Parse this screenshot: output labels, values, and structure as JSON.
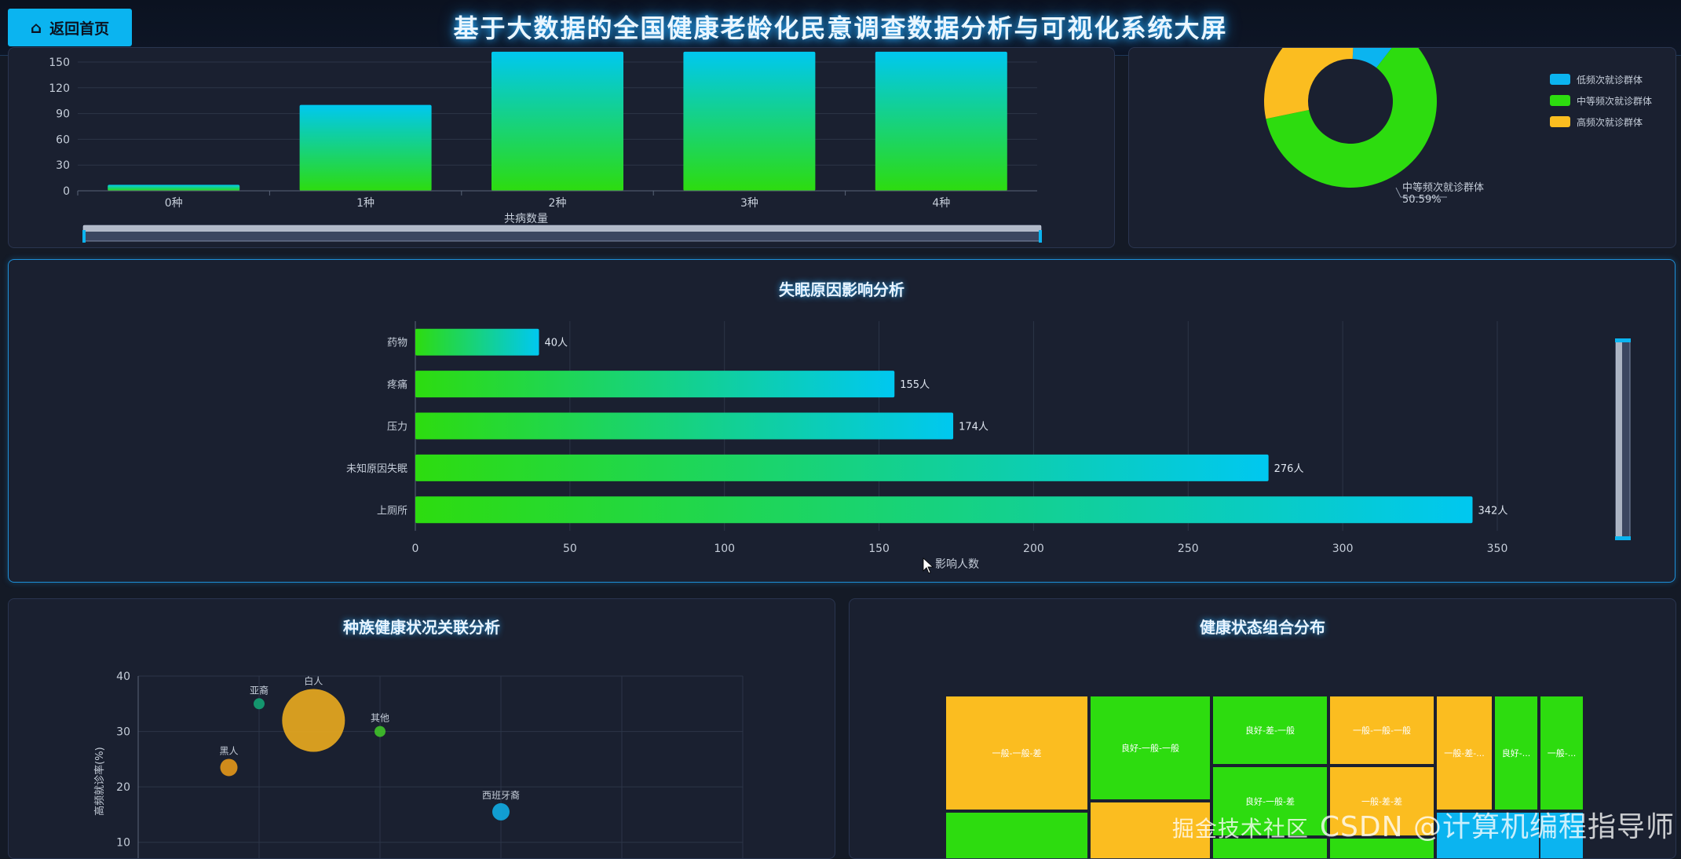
{
  "header": {
    "back_label": "返回首页",
    "title": "基于大数据的全国健康老龄化民意调查数据分析与可视化系统大屏"
  },
  "watermark": "CSDN @计算机编程指导师",
  "watermark2": "掘金技术社区",
  "colors": {
    "accent": "#0bb4f0",
    "green": "#2ddc0f",
    "cyan": "#00c8f0",
    "orange": "#fbbd20",
    "panel": "#1a2030"
  },
  "panels": {
    "insomnia_title": "失眠原因影响分析",
    "race_title": "种族健康状况关联分析",
    "health_title": "健康状态组合分布"
  },
  "chart_data": [
    {
      "type": "bar",
      "categories": [
        "0种",
        "1种",
        "2种",
        "3种",
        "4种"
      ],
      "values": [
        7,
        100,
        165,
        165,
        165
      ],
      "ylim": [
        0,
        150
      ],
      "yticks": [
        "150",
        "120",
        "90",
        "60",
        "30",
        "0"
      ],
      "xlabel": "共病数量",
      "ylabel": "",
      "title": ""
    },
    {
      "type": "pie",
      "legend": [
        "低频次就诊群体",
        "中等频次就诊群体",
        "高频次就诊群体"
      ],
      "values": [
        8,
        50.59,
        24
      ],
      "callout": {
        "name": "中等频次就诊群体",
        "pct": "50.59%"
      },
      "colors": [
        "#0bb4f0",
        "#2ddc0f",
        "#fbbd20"
      ]
    },
    {
      "type": "bar",
      "orientation": "horizontal",
      "categories": [
        "药物",
        "疼痛",
        "压力",
        "未知原因失眠",
        "上厕所"
      ],
      "values": [
        40,
        155,
        174,
        276,
        342
      ],
      "labels": [
        "40人",
        "155人",
        "174人",
        "276人",
        "342人"
      ],
      "xlim": [
        0,
        350
      ],
      "xticks": [
        "0",
        "50",
        "100",
        "150",
        "200",
        "250",
        "300",
        "350"
      ],
      "xlabel": "影响人数",
      "title": "失眠原因影响分析"
    },
    {
      "type": "scatter",
      "points": [
        {
          "name": "亚裔",
          "x": 1.0,
          "y": 35,
          "size": 14,
          "color": "#13a073"
        },
        {
          "name": "白人",
          "x": 1.45,
          "y": 32,
          "size": 80,
          "color": "#e6a81f"
        },
        {
          "name": "黑人",
          "x": 0.75,
          "y": 23.5,
          "size": 22,
          "color": "#e0951a"
        },
        {
          "name": "其他",
          "x": 2.0,
          "y": 30,
          "size": 14,
          "color": "#3fbf2a"
        },
        {
          "name": "西班牙裔",
          "x": 3.0,
          "y": 15.5,
          "size": 22,
          "color": "#10a8e0"
        }
      ],
      "ylim": [
        5,
        40
      ],
      "yticks": [
        "40",
        "30",
        "20",
        "10"
      ],
      "ylabel": "高频就诊率(%)",
      "title": "种族健康状况关联分析"
    },
    {
      "type": "treemap",
      "labels": [
        "一般-一般-差",
        "良好-一般-一般",
        "良好-差-一般",
        "一般-一般-一般",
        "一般-差-...",
        "良好-...",
        "一般-..."
      ],
      "labels_row2": [
        "良好-一般-差",
        "一般-差-差"
      ],
      "title": "健康状态组合分布"
    }
  ]
}
